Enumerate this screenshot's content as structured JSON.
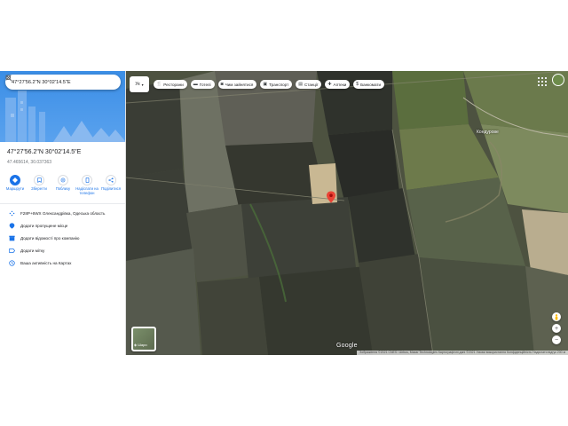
{
  "search": {
    "query": "47°27'56.2\"N 30°02'14.5\"E"
  },
  "place": {
    "title": "47°27'56.2\"N 30°02'14.5\"E",
    "decimal": "47.465614, 30.037363"
  },
  "actions": [
    {
      "label": "Маршрути",
      "icon": "directions-icon"
    },
    {
      "label": "Зберегти",
      "icon": "bookmark-icon"
    },
    {
      "label": "Поблизу",
      "icon": "nearby-icon"
    },
    {
      "label": "Надіслати на телефон",
      "icon": "phone-icon"
    },
    {
      "label": "Поділитися",
      "icon": "share-icon"
    }
  ],
  "info_rows": [
    {
      "text": "F28P+6WX Олександрівка, Одеська область",
      "icon": "plus-code-icon"
    },
    {
      "text": "Додати пропущене місце",
      "icon": "add-place-icon"
    },
    {
      "text": "Додати відомості про компанію",
      "icon": "business-icon"
    },
    {
      "text": "Додати мітку",
      "icon": "label-icon"
    },
    {
      "text": "Ваша активність на Картах",
      "icon": "history-icon"
    }
  ],
  "map": {
    "language": "Ук",
    "chips": [
      {
        "label": "Ресторани",
        "icon": "restaurant-icon"
      },
      {
        "label": "Готелі",
        "icon": "hotel-icon"
      },
      {
        "label": "Чим зайнятися",
        "icon": "camera-icon"
      },
      {
        "label": "Транспорт",
        "icon": "transit-icon"
      },
      {
        "label": "Станції",
        "icon": "fuel-icon"
      },
      {
        "label": "Аптеки",
        "icon": "pharmacy-icon"
      },
      {
        "label": "Банкомати",
        "icon": "atm-icon"
      }
    ],
    "village_label": "Кондурове",
    "layer_label": "Шари",
    "logo": "Google",
    "attribution": "Зображення ©2021 CNES / Airbus, Maxar Technologies  Картографічні дані ©2021  Умови використання  Конфіденційність  Надіслати відгук  200 м",
    "zoom_in": "+",
    "zoom_out": "−",
    "marker_color": "#ea4335"
  }
}
